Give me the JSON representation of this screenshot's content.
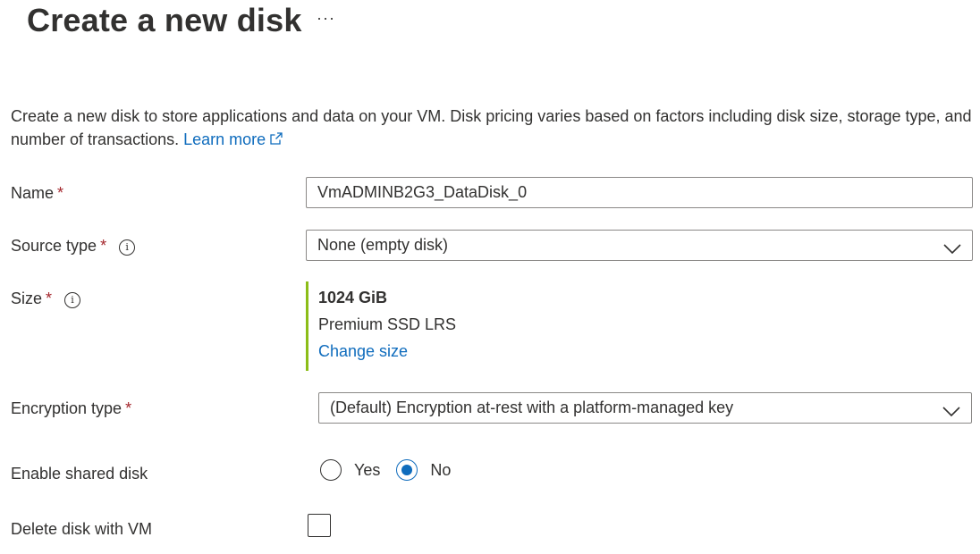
{
  "header": {
    "title": "Create a new disk",
    "more_label": "···"
  },
  "description": {
    "text": "Create a new disk to store applications and data on your VM. Disk pricing varies based on factors including disk size, storage type, and number of transactions.",
    "learn_more": "Learn more"
  },
  "form": {
    "required_marker": "*",
    "name": {
      "label": "Name",
      "value": "VmADMINB2G3_DataDisk_0"
    },
    "source_type": {
      "label": "Source type",
      "value": "None (empty disk)"
    },
    "size": {
      "label": "Size",
      "gib": "1024 GiB",
      "sku": "Premium SSD LRS",
      "change_link": "Change size"
    },
    "encryption_type": {
      "label": "Encryption type",
      "value": "(Default) Encryption at-rest with a platform-managed key"
    },
    "shared_disk": {
      "label": "Enable shared disk",
      "yes": "Yes",
      "no": "No",
      "selected": "No"
    },
    "delete_with_vm": {
      "label": "Delete disk with VM",
      "checked": false
    }
  },
  "colors": {
    "accent": "#0f6cbd",
    "required": "#a4262c",
    "size_bar": "#8cbd18",
    "text": "#323130"
  },
  "icons": {
    "info": "info-icon",
    "external_link": "external-link-icon",
    "dropdown": "chevron-down-icon"
  },
  "info_glyph": "i"
}
